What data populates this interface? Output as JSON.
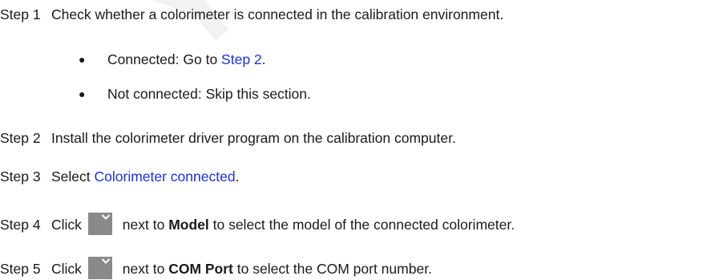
{
  "watermark": "Y'AN NO",
  "steps": [
    {
      "num": "Step 1",
      "text": "Check whether a colorimeter is connected in the calibration environment."
    },
    {
      "num": "Step 2",
      "text": "Install the colorimeter driver program on the calibration computer."
    },
    {
      "num": "Step 3",
      "text_before": "Select ",
      "link": "Colorimeter connected",
      "text_after": "."
    },
    {
      "num": "Step 4",
      "click": "Click",
      "after_icon": " next to ",
      "bold": "Model",
      "rest": " to select the model of the connected colorimeter."
    },
    {
      "num": "Step 5",
      "click": "Click",
      "after_icon": " next to ",
      "bold": "COM Port",
      "rest": " to select the COM port number."
    }
  ],
  "bullets": [
    {
      "mark": "●",
      "text": "Connected: Go to ",
      "link": "Step 2",
      "after": "."
    },
    {
      "mark": "●",
      "text": "Not connected: Skip this section."
    }
  ],
  "icons": {
    "dropdown": "chevron-down-icon"
  }
}
